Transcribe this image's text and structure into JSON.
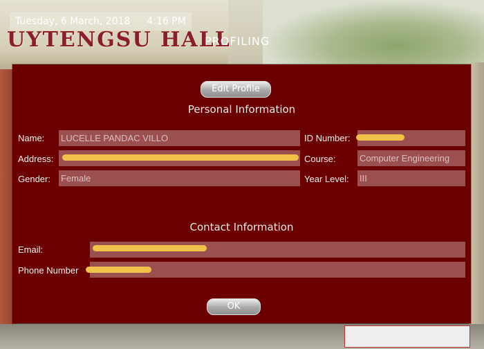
{
  "header": {
    "date": "Tuesday, 6 March, 2018",
    "time": "4:16 PM",
    "hall_name": "UYTENGSU HALL",
    "app_name": "PROFILING"
  },
  "panel": {
    "edit_button": "Edit Profile",
    "personal_title": "Personal Information",
    "contact_title": "Contact Information",
    "ok_button": "OK",
    "fields": {
      "name_label": "Name:",
      "name_value": "LUCELLE    PANDAC VILLO",
      "id_label": "ID Number:",
      "id_value": "",
      "address_label": "Address:",
      "address_value": "",
      "course_label": "Course:",
      "course_value": "Computer Engineering",
      "gender_label": "Gender:",
      "gender_value": "Female",
      "year_label": "Year Level:",
      "year_value": "III",
      "email_label": "Email:",
      "email_value": "",
      "phone_label": "Phone Number",
      "phone_value": ""
    }
  },
  "colors": {
    "panel_bg": "#6b0000",
    "field_bg": "#9b4f4f",
    "redaction": "#f1c24a",
    "title_red": "#8a1f2b"
  }
}
